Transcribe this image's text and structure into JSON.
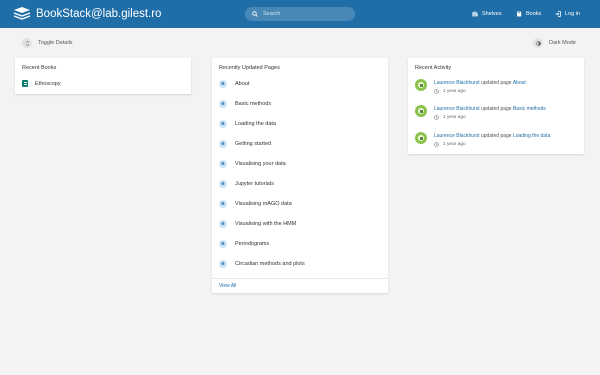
{
  "header": {
    "site_name": "BookStack@lab.gilest.ro",
    "search_placeholder": "Search",
    "nav": [
      {
        "label": "Shelves",
        "icon": "shelves-icon"
      },
      {
        "label": "Books",
        "icon": "books-icon"
      },
      {
        "label": "Log in",
        "icon": "login-icon"
      }
    ]
  },
  "toolbar": {
    "toggle_details": "Toggle Details",
    "dark_mode": "Dark Mode"
  },
  "recent_books": {
    "title": "Recent Books",
    "items": [
      "Ethoscopy"
    ]
  },
  "recent_pages": {
    "title": "Recently Updated Pages",
    "items": [
      "About",
      "Basic methods",
      "Loading the data",
      "Getting started",
      "Visualising your data",
      "Jupyter tutorials",
      "Visualising mAGO data",
      "Visualising with the HMM",
      "Periodograms",
      "Circadian methods and plots"
    ],
    "view_all": "View All"
  },
  "recent_activity": {
    "title": "Recent Activity",
    "items": [
      {
        "user": "Laurence Blackhurst",
        "action": "updated page",
        "page": "About",
        "time": "1 year ago"
      },
      {
        "user": "Laurence Blackhurst",
        "action": "updated page",
        "page": "Basic methods",
        "time": "1 year ago"
      },
      {
        "user": "Laurence Blackhurst",
        "action": "updated page",
        "page": "Loading the data",
        "time": "1 year ago"
      }
    ]
  },
  "colors": {
    "header": "#206ea7",
    "link": "#206ea7",
    "book": "#077b70",
    "background": "#f3f3f3"
  }
}
